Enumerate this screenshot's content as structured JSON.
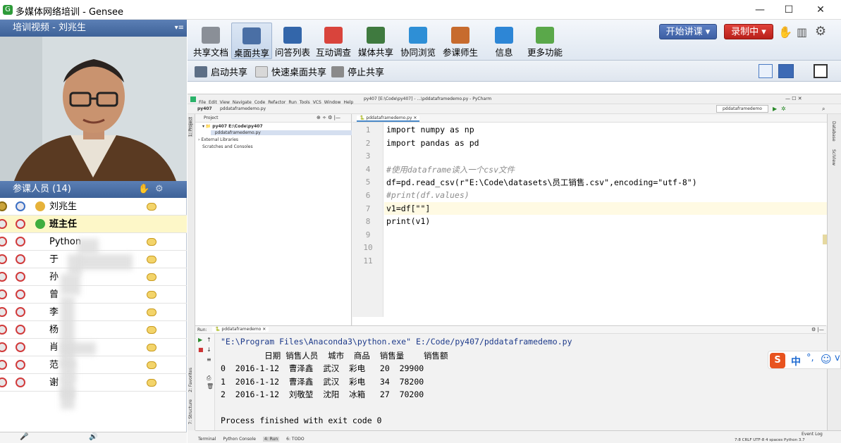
{
  "window": {
    "title": "多媒体网络培训 - Gensee",
    "minimize": "—",
    "maximize": "☐",
    "close": "✕"
  },
  "video_panel": {
    "title": "培训视频 - 刘兆生"
  },
  "participants": {
    "title": "参课人员 (14)",
    "rows": [
      {
        "name": "刘兆生"
      },
      {
        "name": "班主任"
      },
      {
        "name": "Python"
      },
      {
        "name": "于"
      },
      {
        "name": "孙"
      },
      {
        "name": "曾"
      },
      {
        "name": "李"
      },
      {
        "name": "杨"
      },
      {
        "name": "肖"
      },
      {
        "name": "范"
      },
      {
        "name": "谢"
      }
    ]
  },
  "toolbar": {
    "items": [
      {
        "label": "共享文档",
        "color": "#8a8f97"
      },
      {
        "label": "桌面共享",
        "color": "#4a6fa5"
      },
      {
        "label": "问答列表",
        "color": "#3366aa"
      },
      {
        "label": "互动调查",
        "color": "#d9443c"
      },
      {
        "label": "媒体共享",
        "color": "#3f7a3f"
      },
      {
        "label": "协同浏览",
        "color": "#2e8fd6"
      },
      {
        "label": "参课师生",
        "color": "#c76b2e"
      },
      {
        "label": "信息",
        "color": "#2d86d6"
      },
      {
        "label": "更多功能",
        "color": "#5aa84a"
      }
    ],
    "start_lecture": "开始讲课 ▾",
    "recording": "录制中 ▾"
  },
  "subbar": {
    "start_share": "启动共享",
    "quick_share": "快速桌面共享",
    "stop_share": "停止共享"
  },
  "ide": {
    "menu": [
      "File",
      "Edit",
      "View",
      "Navigate",
      "Code",
      "Refactor",
      "Run",
      "Tools",
      "VCS",
      "Window",
      "Help"
    ],
    "window_title": "py407 [E:\\Code\\py407] - ...\\pddataframedemo.py - PyCharm",
    "breadcrumb_project": "py407",
    "breadcrumb_file": "pddataframedemo.py",
    "run_config": "pddataframedemo",
    "project_tab": "Project",
    "tree": [
      "py407  E:\\Code\\py407",
      "pddataframedemo.py",
      "External Libraries",
      "Scratches and Consoles"
    ],
    "editor_tab": "pddataframedemo.py",
    "code_lines": [
      {
        "n": "1",
        "text": "import numpy as np"
      },
      {
        "n": "2",
        "text": "import pandas as pd"
      },
      {
        "n": "3",
        "text": ""
      },
      {
        "n": "4",
        "text": "#使用dataframe读入一个csv文件"
      },
      {
        "n": "5",
        "text": "df=pd.read_csv(r\"E:\\Code\\datasets\\员工销售.csv\",encoding=\"utf-8\")"
      },
      {
        "n": "6",
        "text": "#print(df.values)"
      },
      {
        "n": "7",
        "text": "v1=df[\"\"]"
      },
      {
        "n": "8",
        "text": "print(v1)"
      },
      {
        "n": "9",
        "text": ""
      },
      {
        "n": "10",
        "text": ""
      },
      {
        "n": "11",
        "text": ""
      }
    ],
    "run_tab": "Run:",
    "run_name": "pddataframedemo",
    "output": [
      "\"E:\\Program Files\\Anaconda3\\python.exe\" E:/Code/py407/pddataframedemo.py",
      "         日期 销售人员  城市  商品  销售量    销售额",
      "0  2016-1-12  曹泽鑫  武汉  彩电   20  29900",
      "1  2016-1-12  曹泽鑫  武汉  彩电   34  78200",
      "2  2016-1-12  刘敬堃  沈阳  冰箱   27  70200",
      "",
      "Process finished with exit code 0"
    ],
    "bottom_tabs": [
      "Terminal",
      "Python Console",
      "4: Run",
      "6: TODO"
    ],
    "event_log": "Event Log",
    "status_right": "7:8  CRLF  UTF-8  4 spaces  Python 3.7",
    "side_tabs": [
      "1: Project",
      "2: Favorites",
      "7: Structure"
    ],
    "right_tabs": [
      "Database",
      "SciView"
    ]
  },
  "ime": {
    "label": "中"
  }
}
